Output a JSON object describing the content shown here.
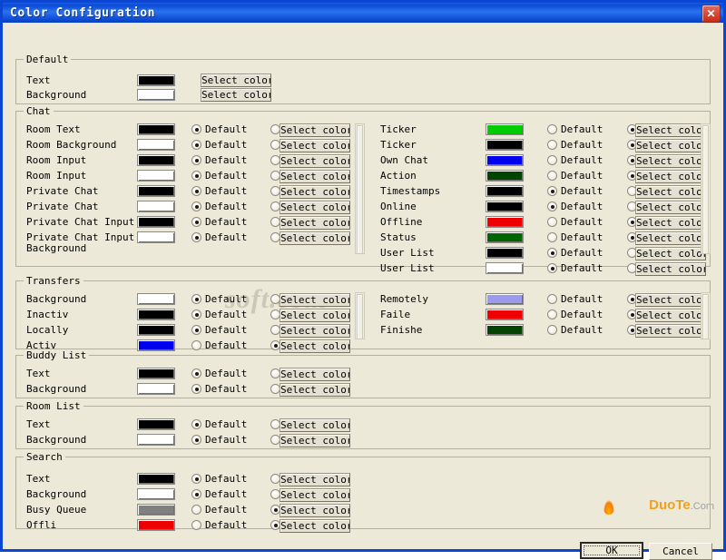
{
  "window": {
    "title": "Color Configuration",
    "close_label": "✕",
    "accent": "#0a46d2",
    "face": "#ece9d8"
  },
  "common": {
    "default_label": "Default",
    "select_color_label": "Select color"
  },
  "groups": {
    "default": {
      "legend": "Default",
      "rows": [
        {
          "label": "Text",
          "color": "#000000",
          "select_label": "Select color"
        },
        {
          "label": "Background",
          "color": "#ffffff",
          "select_label": "Select color"
        }
      ]
    },
    "chat": {
      "legend": "Chat",
      "left_rows": [
        {
          "label": "Room Text",
          "color": "#000000",
          "default_on": true,
          "select_on": false
        },
        {
          "label": "Room Background",
          "color": "#ffffff",
          "default_on": true,
          "select_on": false
        },
        {
          "label": "Room Input",
          "color": "#000000",
          "default_on": true,
          "select_on": false
        },
        {
          "label": "Room Input",
          "color": "#ffffff",
          "default_on": true,
          "select_on": false
        },
        {
          "label": "Private Chat",
          "color": "#000000",
          "default_on": true,
          "select_on": false
        },
        {
          "label": "Private Chat",
          "color": "#ffffff",
          "default_on": true,
          "select_on": false
        },
        {
          "label": "Private Chat Input",
          "color": "#000000",
          "default_on": true,
          "select_on": false
        },
        {
          "label": "Private Chat Input Background",
          "color": "#ffffff",
          "default_on": true,
          "select_on": false
        }
      ],
      "right_rows": [
        {
          "label": "Ticker",
          "color": "#00cc00",
          "default_on": false,
          "select_on": true
        },
        {
          "label": "Ticker",
          "color": "#000000",
          "default_on": false,
          "select_on": true
        },
        {
          "label": "Own Chat",
          "color": "#0000ee",
          "default_on": false,
          "select_on": true
        },
        {
          "label": "Action",
          "color": "#004400",
          "default_on": false,
          "select_on": true
        },
        {
          "label": "Timestamps",
          "color": "#000000",
          "default_on": true,
          "select_on": false
        },
        {
          "label": "Online",
          "color": "#000000",
          "default_on": true,
          "select_on": false
        },
        {
          "label": "Offline",
          "color": "#ee0000",
          "default_on": false,
          "select_on": true
        },
        {
          "label": "Status",
          "color": "#006400",
          "default_on": false,
          "select_on": true
        },
        {
          "label": "User List",
          "color": "#000000",
          "default_on": true,
          "select_on": false
        },
        {
          "label": "User List",
          "color": "#ffffff",
          "default_on": true,
          "select_on": false
        }
      ]
    },
    "transfers": {
      "legend": "Transfers",
      "left_rows": [
        {
          "label": "Background",
          "color": "#ffffff",
          "default_on": true,
          "select_on": false
        },
        {
          "label": "Inactiv",
          "color": "#000000",
          "default_on": true,
          "select_on": false
        },
        {
          "label": "Locally",
          "color": "#000000",
          "default_on": true,
          "select_on": false
        },
        {
          "label": "Activ",
          "color": "#0000ee",
          "default_on": false,
          "select_on": true
        }
      ],
      "right_rows": [
        {
          "label": "Remotely",
          "color": "#9a9aee",
          "default_on": false,
          "select_on": true
        },
        {
          "label": "Faile",
          "color": "#ee0000",
          "default_on": false,
          "select_on": true
        },
        {
          "label": "Finishe",
          "color": "#004400",
          "default_on": false,
          "select_on": true
        }
      ]
    },
    "buddy_list": {
      "legend": "Buddy List",
      "rows": [
        {
          "label": "Text",
          "color": "#000000",
          "default_on": true,
          "select_on": false
        },
        {
          "label": "Background",
          "color": "#ffffff",
          "default_on": true,
          "select_on": false
        }
      ]
    },
    "room_list": {
      "legend": "Room List",
      "rows": [
        {
          "label": "Text",
          "color": "#000000",
          "default_on": true,
          "select_on": false
        },
        {
          "label": "Background",
          "color": "#ffffff",
          "default_on": true,
          "select_on": false
        }
      ]
    },
    "search": {
      "legend": "Search",
      "rows": [
        {
          "label": "Text",
          "color": "#000000",
          "default_on": true,
          "select_on": false
        },
        {
          "label": "Background",
          "color": "#ffffff",
          "default_on": true,
          "select_on": false
        },
        {
          "label": "Busy Queue",
          "color": "#808080",
          "default_on": false,
          "select_on": true
        },
        {
          "label": "Offli",
          "color": "#ee0000",
          "default_on": false,
          "select_on": true
        }
      ]
    }
  },
  "footer": {
    "ok_label": "OK",
    "cancel_label": "Cancel"
  },
  "watermarks": {
    "center": "soft.com",
    "brand": "DuoTe",
    "brand_suffix": ".Com"
  }
}
